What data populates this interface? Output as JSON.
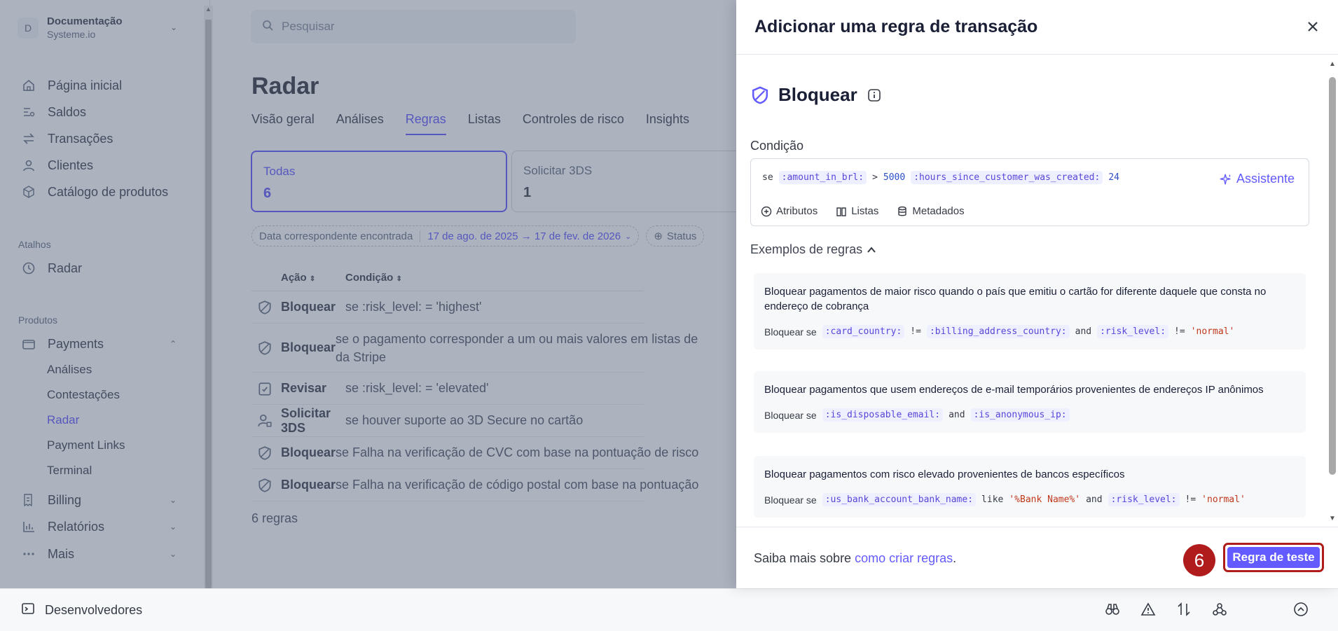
{
  "account": {
    "avatar": "D",
    "name": "Documentação",
    "sub": "Systeme.io"
  },
  "sidebar": {
    "items": [
      {
        "label": "Página inicial",
        "icon": "home-icon"
      },
      {
        "label": "Saldos",
        "icon": "balances-icon"
      },
      {
        "label": "Transações",
        "icon": "arrows-icon"
      },
      {
        "label": "Clientes",
        "icon": "person-icon"
      },
      {
        "label": "Catálogo de produtos",
        "icon": "box-icon"
      }
    ],
    "shortcuts_label": "Atalhos",
    "shortcut": "Radar",
    "products_label": "Produtos",
    "payments": "Payments",
    "payments_sub": [
      "Análises",
      "Contestações",
      "Radar",
      "Payment Links",
      "Terminal"
    ],
    "billing": "Billing",
    "reports": "Relatórios",
    "more": "Mais"
  },
  "search": {
    "placeholder": "Pesquisar"
  },
  "page": {
    "title": "Radar",
    "tabs": [
      "Visão geral",
      "Análises",
      "Regras",
      "Listas",
      "Controles de risco",
      "Insights"
    ],
    "active_tab": "Regras",
    "cards": [
      {
        "label": "Todas",
        "count": "6"
      },
      {
        "label": "Solicitar 3DS",
        "count": "1"
      }
    ],
    "filter": {
      "label": "Data correspondente encontrada",
      "value": "17 de ago. de 2025 → 17 de fev. de 2026",
      "status": "Status"
    },
    "table": {
      "headers": [
        "Ação",
        "Condição"
      ],
      "rows": [
        {
          "action": "Bloquear",
          "condition": "se :risk_level: = 'highest'"
        },
        {
          "action": "Bloquear",
          "condition": "se o pagamento corresponder a um ou mais valores em listas de",
          "condition2": "da Stripe"
        },
        {
          "action": "Revisar",
          "condition": "se :risk_level: = 'elevated'"
        },
        {
          "action": "Solicitar 3DS",
          "condition": "se houver suporte ao 3D Secure no cartão"
        },
        {
          "action": "Bloquear",
          "condition": "se Falha na verificação de CVC com base na pontuação de risco"
        },
        {
          "action": "Bloquear",
          "condition": "se Falha na verificação de código postal com base na pontuação"
        }
      ],
      "footer": "6 regras"
    }
  },
  "bottom": {
    "developers": "Desenvolvedores"
  },
  "drawer": {
    "title": "Adicionar uma regra de transação",
    "action": "Bloquear",
    "condition_label": "Condição",
    "condition": {
      "se": "se",
      "attr1": ":amount_in_brl:",
      "op1": ">",
      "val1": "5000",
      "attr2": ":hours_since_customer_was_created:",
      "val2": "24"
    },
    "assistant": "Assistente",
    "tools": [
      "Atributos",
      "Listas",
      "Metadados"
    ],
    "examples_title": "Exemplos de regras",
    "examples": [
      {
        "desc": "Bloquear pagamentos de maior risco quando o país que emitiu o cartão for diferente daquele que consta no endereço de cobrança",
        "prefix": "Bloquear se",
        "t1": ":card_country:",
        "o1": "!=",
        "t2": ":billing_address_country:",
        "o2": "and",
        "t3": ":risk_level:",
        "o3": "!=",
        "s1": "'normal'"
      },
      {
        "desc": "Bloquear pagamentos que usem endereços de e-mail temporários provenientes de endereços IP anônimos",
        "prefix": "Bloquear se",
        "t1": ":is_disposable_email:",
        "o1": "and",
        "t2": ":is_anonymous_ip:"
      },
      {
        "desc": "Bloquear pagamentos com risco elevado provenientes de bancos específicos",
        "prefix": "Bloquear se",
        "t1": ":us_bank_account_bank_name:",
        "o1": "like",
        "s1": "'%Bank Name%'",
        "o2": "and",
        "t2": ":risk_level:",
        "o3": "!=",
        "s2": "'normal'"
      }
    ],
    "footer_text": "Saiba mais sobre",
    "footer_link": "como criar regras",
    "footer_dot": ".",
    "step": "6",
    "test_button": "Regra de teste"
  },
  "colors": {
    "accent": "#635bff",
    "highlight": "#b01c1c",
    "overlay": "#47546e"
  }
}
